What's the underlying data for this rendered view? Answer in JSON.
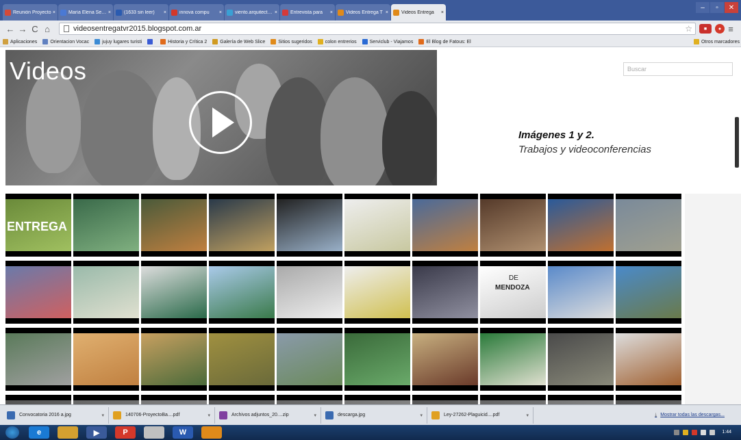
{
  "browser": {
    "tabs": [
      {
        "label": "Reunión Proyecto",
        "color": "#d44a3a"
      },
      {
        "label": "María Elena Serra",
        "color": "#4a79d4"
      },
      {
        "label": "(1633 sin leer)",
        "color": "#2a5bb0"
      },
      {
        "label": "innova compu",
        "color": "#d4382a"
      },
      {
        "label": "viento.arquitectura",
        "color": "#3aa0d4"
      },
      {
        "label": "Entrevista para",
        "color": "#d43a3a"
      },
      {
        "label": "Videos Entrega T",
        "color": "#e08a1a"
      },
      {
        "label": "Videos Entrega",
        "color": "#e08a1a"
      }
    ],
    "url": "videosentregatvr2015.blogspot.com.ar",
    "bookmarks": [
      {
        "label": "Aplicaciones",
        "color": "#d0a040"
      },
      {
        "label": "Orientacion Vocac",
        "color": "#6080c0"
      },
      {
        "label": "jujuy lugares turisti",
        "color": "#3a8ad4"
      },
      {
        "label": "",
        "color": "#3a5bd4"
      },
      {
        "label": "Historia y Crítica 2",
        "color": "#e06a1a"
      },
      {
        "label": "Galería de Web Slice",
        "color": "#d09a20"
      },
      {
        "label": "Sitios sugeridos",
        "color": "#e08a1a"
      },
      {
        "label": "colon entrerios",
        "color": "#e0b020"
      },
      {
        "label": "Serviclub - Viajamos",
        "color": "#2a6ad4"
      },
      {
        "label": "El Blog de Fatous: El",
        "color": "#e06a1a"
      }
    ],
    "bookmarks_more": "Otros marcadores"
  },
  "page": {
    "hero_title": "Videos",
    "search_placeholder": "Buscar",
    "caption_title": "Imágenes 1 y 2.",
    "caption_subtitle": "Trabajos y videoconferencias",
    "first_thumb_text": "ENTREGA",
    "mendoza_de": "DE",
    "mendoza_name": "MENDOZA"
  },
  "downloads": {
    "items": [
      {
        "label": "Convocatoria 2016 a.jpg",
        "color": "#3a6ab0"
      },
      {
        "label": "140706-ProyectoBa....pdf",
        "color": "#e0a020"
      },
      {
        "label": "Archivos adjuntos_20....zip",
        "color": "#8040a0"
      },
      {
        "label": "descarga.jpg",
        "color": "#3a6ab0"
      },
      {
        "label": "Ley-27262-Plaguicid....pdf",
        "color": "#e0a020"
      }
    ],
    "show_all": "Mostrar todas las descargas..."
  },
  "taskbar": {
    "clock_time": "1:44",
    "pinned": [
      {
        "glyph": "e",
        "color": "#1a7ad4"
      },
      {
        "glyph": "",
        "color": "#d4a030"
      },
      {
        "glyph": "▶",
        "color": "#3a5a9a"
      },
      {
        "glyph": "P",
        "color": "#d4382a"
      },
      {
        "glyph": "",
        "color": "#c0c0c0"
      },
      {
        "glyph": "W",
        "color": "#2a5ab0"
      },
      {
        "glyph": "",
        "color": "#e08a1a"
      }
    ]
  }
}
